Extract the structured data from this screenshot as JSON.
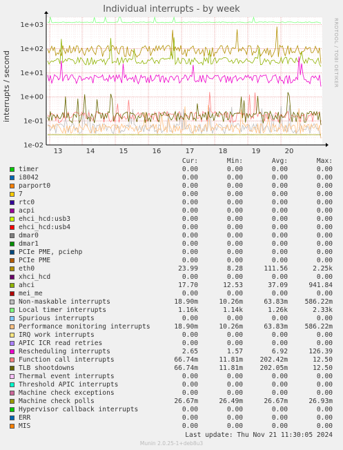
{
  "chart_data": {
    "type": "line",
    "title": "Individual interrupts - by week",
    "side_label": "RRDTOOL / TOBI OETIKER",
    "ylabel": "interrupts / second",
    "yscale": "log",
    "ylim": [
      0.01,
      2000
    ],
    "y_ticks": [
      "1e-02",
      "1e-01",
      "1e+00",
      "1e+01",
      "1e+02",
      "1e+03"
    ],
    "x_ticks": [
      "13",
      "14",
      "15",
      "16",
      "17",
      "18",
      "19",
      "20"
    ],
    "grid": true,
    "columns": [
      "Cur:",
      "Min:",
      "Avg:",
      "Max:"
    ],
    "series": [
      {
        "name": "timer",
        "color": "#00cc00",
        "values": [
          "0.00",
          "0.00",
          "0.00",
          "0.00"
        ]
      },
      {
        "name": "i8042",
        "color": "#0066b3",
        "values": [
          "0.00",
          "0.00",
          "0.00",
          "0.00"
        ]
      },
      {
        "name": "parport0",
        "color": "#ff8000",
        "values": [
          "0.00",
          "0.00",
          "0.00",
          "0.00"
        ]
      },
      {
        "name": "7",
        "color": "#ffcc00",
        "values": [
          "0.00",
          "0.00",
          "0.00",
          "0.00"
        ]
      },
      {
        "name": "rtc0",
        "color": "#330099",
        "values": [
          "0.00",
          "0.00",
          "0.00",
          "0.00"
        ]
      },
      {
        "name": "acpi",
        "color": "#990099",
        "values": [
          "0.00",
          "0.00",
          "0.00",
          "0.00"
        ]
      },
      {
        "name": "ehci_hcd:usb3",
        "color": "#ccff00",
        "values": [
          "0.00",
          "0.00",
          "0.00",
          "0.00"
        ]
      },
      {
        "name": "ehci_hcd:usb4",
        "color": "#ff0000",
        "values": [
          "0.00",
          "0.00",
          "0.00",
          "0.00"
        ]
      },
      {
        "name": "dmar0",
        "color": "#808080",
        "values": [
          "0.00",
          "0.00",
          "0.00",
          "0.00"
        ]
      },
      {
        "name": "dmar1",
        "color": "#008f00",
        "values": [
          "0.00",
          "0.00",
          "0.00",
          "0.00"
        ]
      },
      {
        "name": "PCIe PME, pciehp",
        "color": "#00487d",
        "values": [
          "0.00",
          "0.00",
          "0.00",
          "0.00"
        ]
      },
      {
        "name": "PCIe PME",
        "color": "#b35a00",
        "values": [
          "0.00",
          "0.00",
          "0.00",
          "0.00"
        ]
      },
      {
        "name": "eth0",
        "color": "#b38f00",
        "values": [
          "23.99",
          "8.28",
          "111.56",
          "2.25k"
        ]
      },
      {
        "name": "xhci_hcd",
        "color": "#6b006b",
        "values": [
          "0.00",
          "0.00",
          "0.00",
          "0.00"
        ]
      },
      {
        "name": "ahci",
        "color": "#8fb300",
        "values": [
          "17.70",
          "12.53",
          "37.09",
          "941.84"
        ]
      },
      {
        "name": "mei_me",
        "color": "#b30000",
        "values": [
          "0.00",
          "0.00",
          "0.00",
          "0.00"
        ]
      },
      {
        "name": "Non-maskable interrupts",
        "color": "#bebebe",
        "values": [
          "18.90m",
          "10.26m",
          "63.83m",
          "586.22m"
        ]
      },
      {
        "name": "Local timer interrupts",
        "color": "#80ff80",
        "values": [
          "1.16k",
          "1.14k",
          "1.26k",
          "2.33k"
        ]
      },
      {
        "name": "Spurious interrupts",
        "color": "#80c9ff",
        "values": [
          "0.00",
          "0.00",
          "0.00",
          "0.00"
        ]
      },
      {
        "name": "Performance monitoring interrupts",
        "color": "#ffc080",
        "values": [
          "18.90m",
          "10.26m",
          "63.83m",
          "586.22m"
        ]
      },
      {
        "name": "IRQ work interrupts",
        "color": "#ffe680",
        "values": [
          "0.00",
          "0.00",
          "0.00",
          "0.00"
        ]
      },
      {
        "name": "APIC ICR read retries",
        "color": "#aa80ff",
        "values": [
          "0.00",
          "0.00",
          "0.00",
          "0.00"
        ]
      },
      {
        "name": "Rescheduling interrupts",
        "color": "#ee00cc",
        "values": [
          "2.65",
          "1.57",
          "6.92",
          "126.39"
        ]
      },
      {
        "name": "Function call interrupts",
        "color": "#ff8080",
        "values": [
          "66.74m",
          "11.81m",
          "202.42m",
          "12.50"
        ]
      },
      {
        "name": "TLB shootdowns",
        "color": "#666600",
        "values": [
          "66.74m",
          "11.81m",
          "202.05m",
          "12.50"
        ]
      },
      {
        "name": "Thermal event interrupts",
        "color": "#ffbfff",
        "values": [
          "0.00",
          "0.00",
          "0.00",
          "0.00"
        ]
      },
      {
        "name": "Threshold APIC interrupts",
        "color": "#00ffcc",
        "values": [
          "0.00",
          "0.00",
          "0.00",
          "0.00"
        ]
      },
      {
        "name": "Machine check exceptions",
        "color": "#cc6699",
        "values": [
          "0.00",
          "0.00",
          "0.00",
          "0.00"
        ]
      },
      {
        "name": "Machine check polls",
        "color": "#999900",
        "values": [
          "26.67m",
          "26.49m",
          "26.67m",
          "26.93m"
        ]
      },
      {
        "name": "Hypervisor callback interrupts",
        "color": "#00cc00",
        "values": [
          "0.00",
          "0.00",
          "0.00",
          "0.00"
        ]
      },
      {
        "name": "ERR",
        "color": "#0066b3",
        "values": [
          "0.00",
          "0.00",
          "0.00",
          "0.00"
        ]
      },
      {
        "name": "MIS",
        "color": "#ff8000",
        "values": [
          "0.00",
          "0.00",
          "0.00",
          "0.00"
        ]
      }
    ]
  },
  "footer": {
    "last_update": "Last update:  Thu Nov 21 11:30:05 2024",
    "version": "Munin 2.0.25-1+deb8u3"
  }
}
